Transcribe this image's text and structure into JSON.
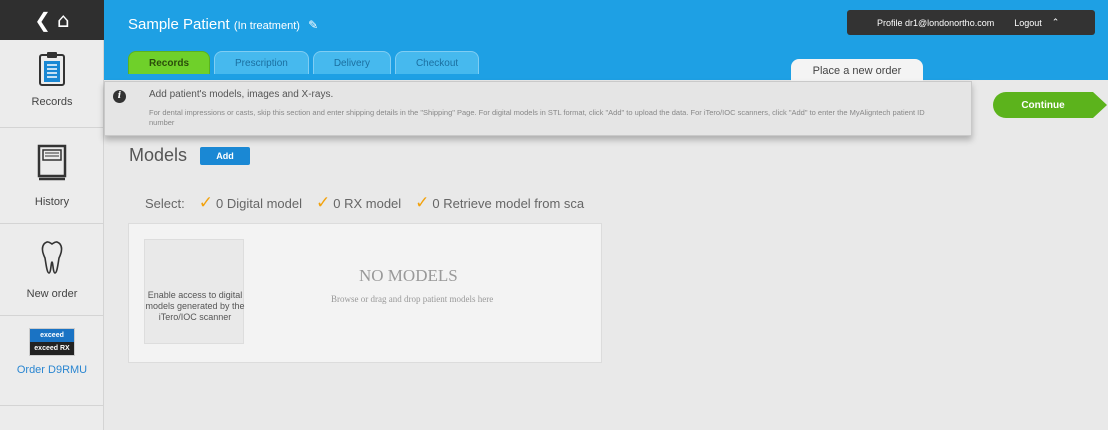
{
  "sidebar": {
    "back_icon": "chevron-left",
    "home_icon": "home",
    "items": [
      {
        "label": "Records",
        "icon": "clipboard-icon"
      },
      {
        "label": "History",
        "icon": "book-icon"
      },
      {
        "label": "New order",
        "icon": "tooth-icon"
      }
    ],
    "exceed_top": "exceed",
    "exceed_bottom": "exceed RX",
    "order_link": "Order D9RMU"
  },
  "header": {
    "patient_name": "Sample Patient",
    "patient_status": "(In treatment)",
    "profile_text": "Profile dr1@londonortho.com",
    "logout_label": "Logout",
    "tabs": [
      "Records",
      "Prescription",
      "Delivery",
      "Checkout"
    ],
    "active_tab": "Records",
    "place_order": "Place a new order",
    "colors": {
      "header": "#1ea0e4",
      "active_tab": "#6fd02a"
    }
  },
  "notice": {
    "title": "Add patient's models, images and X-rays.",
    "body": "For dental impressions or casts, skip this section and enter shipping details in the \"Shipping\" Page. For digital models in STL format, click \"Add\" to upload the data. For iTero/IOC scanners, click \"Add\" to enter the MyAligntech patient ID number"
  },
  "continue_label": "Continue",
  "models": {
    "title": "Models",
    "add_label": "Add",
    "select_label": "Select:",
    "options": [
      "0 Digital model",
      "0 RX model",
      "0 Retrieve model from sca"
    ],
    "itero_text": "Enable access to digital models generated by the iTero/IOC scanner",
    "empty_title": "NO MODELS",
    "empty_sub": "Browse or drag and drop patient models here"
  }
}
